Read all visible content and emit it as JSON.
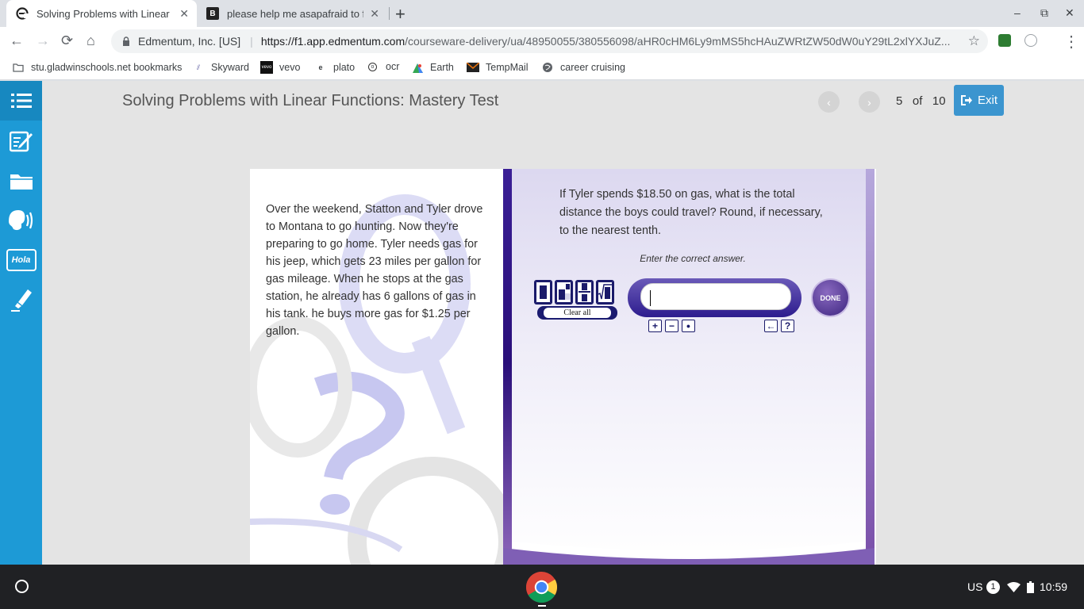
{
  "browser": {
    "tabs": [
      {
        "title": "Solving Problems with Linear Fu",
        "favicon": "edmentum-e-icon",
        "active": true
      },
      {
        "title": "please help me asapafraid to fa",
        "favicon": "brainly-b-icon",
        "active": false
      }
    ],
    "new_tab": "+",
    "window_controls": {
      "minimize": "–",
      "restore": "⧉",
      "close": "✕"
    },
    "nav": {
      "back": "←",
      "forward": "→",
      "reload": "⟳",
      "home": "⌂"
    },
    "origin_label": "Edmentum, Inc. [US]",
    "url_host": "https://f1.app.edmentum.com",
    "url_path": "/courseware-delivery/ua/48950055/380556098/aHR0cHM6Ly9mMS5hcHAuZWRtZW50dW0uY29tL2xlYXJuZ...",
    "bookmark_star": "☆",
    "menu": "⋮"
  },
  "bookmarks": [
    {
      "label": "stu.gladwinschools.net bookmarks",
      "icon": "folder-icon"
    },
    {
      "label": "Skyward",
      "icon": "skyward-icon"
    },
    {
      "label": "vevo",
      "icon": "vevo-icon"
    },
    {
      "label": "plato",
      "icon": "edmentum-icon"
    },
    {
      "label": "ocr",
      "icon": "ocr-icon"
    },
    {
      "label": "Earth",
      "icon": "google-earth-icon"
    },
    {
      "label": "TempMail",
      "icon": "mail-icon"
    },
    {
      "label": "career cruising",
      "icon": "globe-icon"
    }
  ],
  "app": {
    "title": "Solving Problems with Linear Functions: Mastery Test",
    "prev": "‹",
    "next": "›",
    "pager": {
      "current": "5",
      "of": "of",
      "total": "10"
    },
    "exit_label": "Exit",
    "accent": "#1d9ad6"
  },
  "sidebar": [
    {
      "name": "toc-list-icon"
    },
    {
      "name": "notes-icon"
    },
    {
      "name": "folder-icon"
    },
    {
      "name": "text-to-speech-icon"
    },
    {
      "name": "translate-hola-icon",
      "text": "Hola"
    },
    {
      "name": "highlighter-icon"
    }
  ],
  "question": {
    "story": "Over the weekend, Statton and Tyler drove to Montana to go hunting. Now they're preparing to go home. Tyler needs gas for his jeep, which gets 23 miles per gallon for gas mileage. When he stops at the gas station, he already has 6 gallons of gas in his tank. he buys more gas for $1.25 per gallon.",
    "prompt": "If Tyler spends $18.50 on gas, what is the total distance the boys could travel? Round, if necessary, to the nearest tenth.",
    "instruction": "Enter the correct answer.",
    "answer_value": "",
    "clear_all": "Clear all",
    "done_label": "DONE",
    "tools": {
      "plus": "+",
      "minus": "−",
      "dot": "●",
      "backspace": "←",
      "help": "?"
    }
  },
  "tray": {
    "locale": "US",
    "notifications": "1",
    "time": "10:59"
  }
}
